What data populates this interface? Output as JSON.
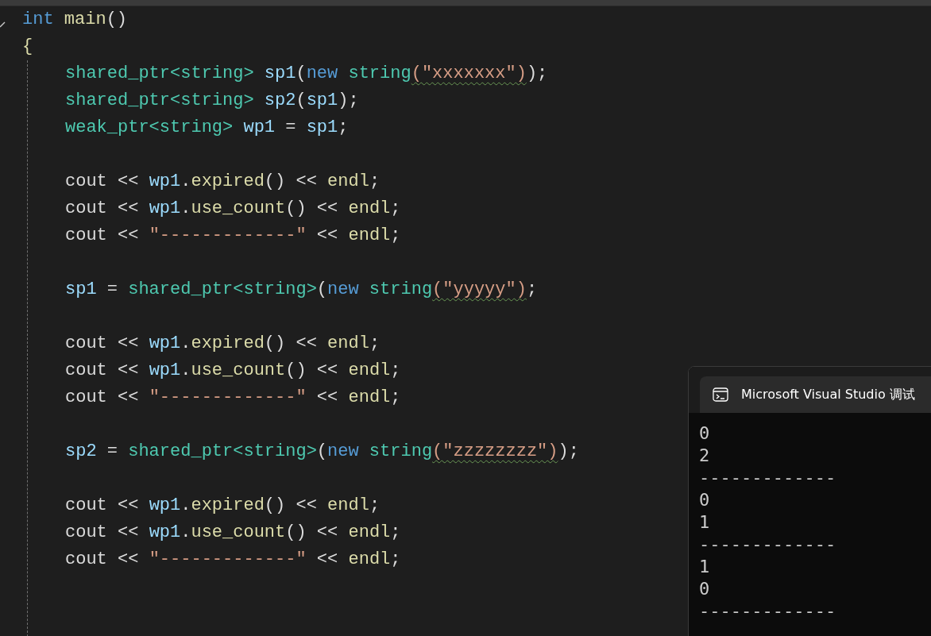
{
  "editor": {
    "signature": [
      {
        "kind": "keyword",
        "text": "int"
      },
      {
        "kind": "func",
        "text": " main"
      },
      {
        "kind": "plain",
        "text": "()"
      }
    ],
    "open_brace": "{",
    "body": [
      {
        "kind": "code",
        "tokens": [
          {
            "kind": "type",
            "text": "shared_ptr<string>"
          },
          {
            "kind": "var",
            "text": " sp1"
          },
          {
            "kind": "plain",
            "text": "("
          },
          {
            "kind": "keyword",
            "text": "new"
          },
          {
            "kind": "type",
            "text": " string"
          },
          {
            "kind": "string",
            "text": "(\"xxxxxxx\")",
            "squiggle": true
          },
          {
            "kind": "plain",
            "text": ");"
          }
        ]
      },
      {
        "kind": "code",
        "tokens": [
          {
            "kind": "type",
            "text": "shared_ptr<string>"
          },
          {
            "kind": "var",
            "text": " sp2"
          },
          {
            "kind": "plain",
            "text": "("
          },
          {
            "kind": "var",
            "text": "sp1"
          },
          {
            "kind": "plain",
            "text": ");"
          }
        ]
      },
      {
        "kind": "code",
        "tokens": [
          {
            "kind": "type",
            "text": "weak_ptr<string>"
          },
          {
            "kind": "var",
            "text": " wp1"
          },
          {
            "kind": "plain",
            "text": " = "
          },
          {
            "kind": "var",
            "text": "sp1"
          },
          {
            "kind": "plain",
            "text": ";"
          }
        ]
      },
      {
        "kind": "blank"
      },
      {
        "kind": "code",
        "tokens": [
          {
            "kind": "plain",
            "text": "cout << "
          },
          {
            "kind": "var",
            "text": "wp1"
          },
          {
            "kind": "plain",
            "text": "."
          },
          {
            "kind": "func",
            "text": "expired"
          },
          {
            "kind": "plain",
            "text": "() << "
          },
          {
            "kind": "func",
            "text": "endl"
          },
          {
            "kind": "plain",
            "text": ";"
          }
        ]
      },
      {
        "kind": "code",
        "tokens": [
          {
            "kind": "plain",
            "text": "cout << "
          },
          {
            "kind": "var",
            "text": "wp1"
          },
          {
            "kind": "plain",
            "text": "."
          },
          {
            "kind": "func",
            "text": "use_count"
          },
          {
            "kind": "plain",
            "text": "() << "
          },
          {
            "kind": "func",
            "text": "endl"
          },
          {
            "kind": "plain",
            "text": ";"
          }
        ]
      },
      {
        "kind": "code",
        "tokens": [
          {
            "kind": "plain",
            "text": "cout << "
          },
          {
            "kind": "string",
            "text": "\"-------------\"",
            "squiggle": false
          },
          {
            "kind": "plain",
            "text": " << "
          },
          {
            "kind": "func",
            "text": "endl"
          },
          {
            "kind": "plain",
            "text": ";"
          }
        ]
      },
      {
        "kind": "blank"
      },
      {
        "kind": "code",
        "tokens": [
          {
            "kind": "var",
            "text": "sp1"
          },
          {
            "kind": "plain",
            "text": " = "
          },
          {
            "kind": "type",
            "text": "shared_ptr<string>"
          },
          {
            "kind": "plain",
            "text": "("
          },
          {
            "kind": "keyword",
            "text": "new"
          },
          {
            "kind": "type",
            "text": " string"
          },
          {
            "kind": "string",
            "text": "(\"yyyyy\")",
            "squiggle": true
          },
          {
            "kind": "plain",
            "text": ";"
          }
        ]
      },
      {
        "kind": "blank"
      },
      {
        "kind": "code",
        "tokens": [
          {
            "kind": "plain",
            "text": "cout << "
          },
          {
            "kind": "var",
            "text": "wp1"
          },
          {
            "kind": "plain",
            "text": "."
          },
          {
            "kind": "func",
            "text": "expired"
          },
          {
            "kind": "plain",
            "text": "() << "
          },
          {
            "kind": "func",
            "text": "endl"
          },
          {
            "kind": "plain",
            "text": ";"
          }
        ]
      },
      {
        "kind": "code",
        "tokens": [
          {
            "kind": "plain",
            "text": "cout << "
          },
          {
            "kind": "var",
            "text": "wp1"
          },
          {
            "kind": "plain",
            "text": "."
          },
          {
            "kind": "func",
            "text": "use_count"
          },
          {
            "kind": "plain",
            "text": "() << "
          },
          {
            "kind": "func",
            "text": "endl"
          },
          {
            "kind": "plain",
            "text": ";"
          }
        ]
      },
      {
        "kind": "code",
        "tokens": [
          {
            "kind": "plain",
            "text": "cout << "
          },
          {
            "kind": "string",
            "text": "\"-------------\"",
            "squiggle": false
          },
          {
            "kind": "plain",
            "text": " << "
          },
          {
            "kind": "func",
            "text": "endl"
          },
          {
            "kind": "plain",
            "text": ";"
          }
        ]
      },
      {
        "kind": "blank"
      },
      {
        "kind": "code",
        "tokens": [
          {
            "kind": "var",
            "text": "sp2"
          },
          {
            "kind": "plain",
            "text": " = "
          },
          {
            "kind": "type",
            "text": "shared_ptr<string>"
          },
          {
            "kind": "plain",
            "text": "("
          },
          {
            "kind": "keyword",
            "text": "new"
          },
          {
            "kind": "type",
            "text": " string"
          },
          {
            "kind": "string",
            "text": "(\"zzzzzzzz\")",
            "squiggle": true
          },
          {
            "kind": "plain",
            "text": ");"
          }
        ]
      },
      {
        "kind": "blank"
      },
      {
        "kind": "code",
        "tokens": [
          {
            "kind": "plain",
            "text": "cout << "
          },
          {
            "kind": "var",
            "text": "wp1"
          },
          {
            "kind": "plain",
            "text": "."
          },
          {
            "kind": "func",
            "text": "expired"
          },
          {
            "kind": "plain",
            "text": "() << "
          },
          {
            "kind": "func",
            "text": "endl"
          },
          {
            "kind": "plain",
            "text": ";"
          }
        ]
      },
      {
        "kind": "code",
        "tokens": [
          {
            "kind": "plain",
            "text": "cout << "
          },
          {
            "kind": "var",
            "text": "wp1"
          },
          {
            "kind": "plain",
            "text": "."
          },
          {
            "kind": "func",
            "text": "use_count"
          },
          {
            "kind": "plain",
            "text": "() << "
          },
          {
            "kind": "func",
            "text": "endl"
          },
          {
            "kind": "plain",
            "text": ";"
          }
        ]
      },
      {
        "kind": "code",
        "tokens": [
          {
            "kind": "plain",
            "text": "cout << "
          },
          {
            "kind": "string",
            "text": "\"-------------\"",
            "squiggle": false
          },
          {
            "kind": "plain",
            "text": " << "
          },
          {
            "kind": "func",
            "text": "endl"
          },
          {
            "kind": "plain",
            "text": ";"
          }
        ]
      }
    ]
  },
  "console": {
    "title": "Microsoft Visual Studio 调试",
    "output": [
      "0",
      "2",
      "-------------",
      "0",
      "1",
      "-------------",
      "1",
      "0",
      "-------------"
    ]
  }
}
